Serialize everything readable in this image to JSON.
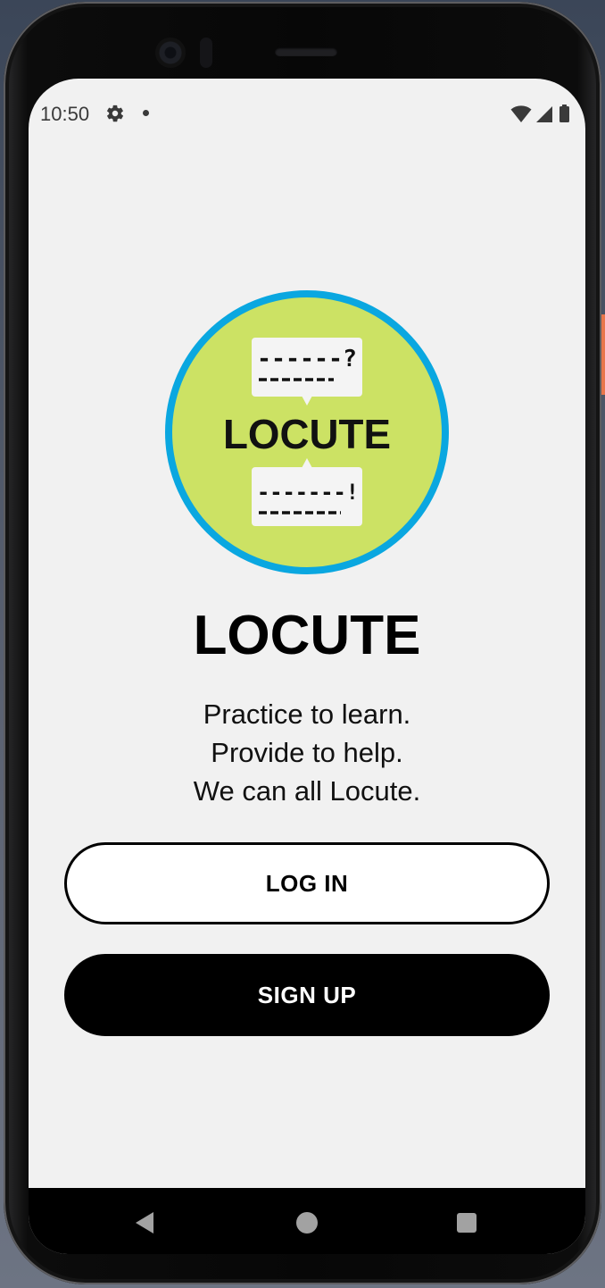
{
  "status_bar": {
    "time": "10:50",
    "left_icons": [
      "gear-icon",
      "notification-dot-icon"
    ],
    "right_icons": [
      "wifi-icon",
      "cell-signal-icon",
      "battery-icon"
    ]
  },
  "logo": {
    "text": "LOCUTE",
    "top_bubble": "------?",
    "bottom_bubble": "-------!",
    "colors": {
      "ring": "#0aa7e0",
      "fill": "#cce264",
      "bubble": "#f4f4f4"
    }
  },
  "main": {
    "title": "LOCUTE",
    "tagline": [
      "Practice to learn.",
      "Provide to help.",
      "We can all Locute."
    ],
    "login_label": "LOG IN",
    "signup_label": "SIGN UP"
  },
  "nav_bar": {
    "icons": [
      "back-icon",
      "home-icon",
      "recents-icon"
    ]
  },
  "colors": {
    "background": "#f1f1f1",
    "primary": "#000000"
  }
}
